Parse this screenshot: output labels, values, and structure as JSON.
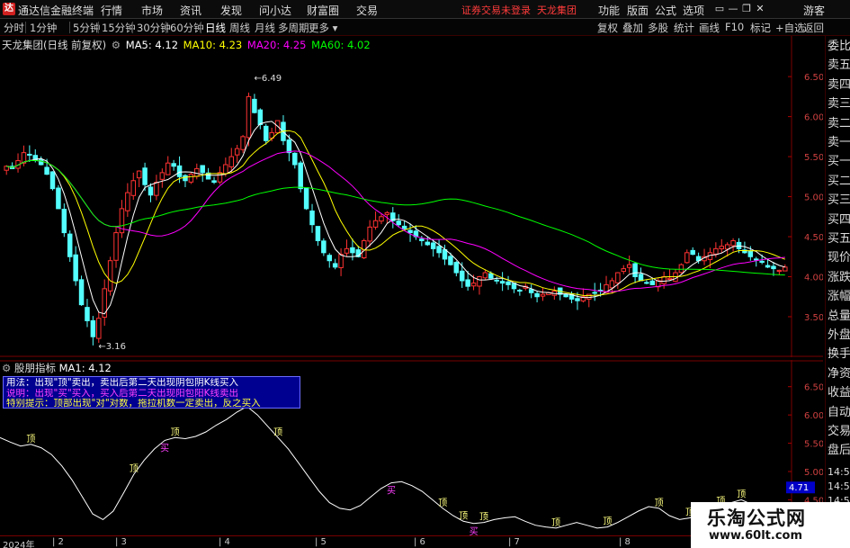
{
  "titlebar": {
    "app_title": "通达信金融终端",
    "logo_glyph": "达",
    "menus": [
      "行情",
      "市场",
      "资讯",
      "发现",
      "问小达",
      "财富圈",
      "交易"
    ],
    "login_notice": "证券交易未登录",
    "stock_name": "天龙集团",
    "right_buttons": [
      "功能",
      "版面",
      "公式",
      "选项"
    ],
    "guest_label": "游客",
    "window_controls": [
      "minimize-icon",
      "maximize-icon",
      "close-icon"
    ]
  },
  "toolbar": {
    "periods": [
      "分时",
      "1分钟",
      "5分钟",
      "15分钟",
      "30分钟",
      "60分钟",
      "日线",
      "周线",
      "月线",
      "多周期",
      "更多"
    ],
    "active_period": "日线",
    "right_buttons": [
      "复权",
      "叠加",
      "多股",
      "统计",
      "画线",
      "F10",
      "标记",
      "+自选",
      "返回"
    ]
  },
  "main_legend": {
    "title": "天龙集团(日线 前复权)",
    "ma5": "MA5: 4.12",
    "ma10": "MA10: 4.23",
    "ma20": "MA20: 4.25",
    "ma60": "MA60: 4.02",
    "colors": {
      "ma5": "#ffffff",
      "ma10": "#ffff00",
      "ma20": "#ff00ff",
      "ma60": "#00ff00"
    }
  },
  "indicator": {
    "name": "股朋指标",
    "ma1": "MA1: 4.12",
    "info_lines": [
      "用法：出现\"顶\"卖出，卖出后第二天出现阴包阴K线买入",
      "说明：出现\"买\"买入，买入后第二天出现阳包阳K线卖出",
      "特别提示：顶部出现\"对\"对数，拖拉机数一定卖出，反之买入"
    ],
    "current_value": "4.71",
    "top_label": "顶",
    "buy_label": "买"
  },
  "right_panel": {
    "labels": [
      "委比",
      "卖五",
      "卖四",
      "卖三",
      "卖二",
      "卖一",
      "买一",
      "买二",
      "买三",
      "买四",
      "买五",
      "现价",
      "涨跌",
      "涨幅",
      "总量",
      "外盘",
      "换手",
      "净资",
      "收益",
      "自动",
      "交易",
      "盘后"
    ],
    "time_labels": [
      "14:5",
      "14:5",
      "14:5",
      "15:0",
      "15:0",
      "15:0"
    ]
  },
  "bottom_axis": {
    "dates": [
      "2024年",
      "2",
      "3",
      "4",
      "5",
      "6",
      "7",
      "8"
    ]
  },
  "watermark": {
    "title": "乐淘公式网",
    "url": "www.60lt.com"
  },
  "chart_data": {
    "type": "candlestick",
    "title": "天龙集团(日线 前复权)",
    "y_axis_ticks": [
      3.5,
      4.0,
      4.5,
      5.0,
      5.5,
      6.0,
      6.5
    ],
    "ylim": [
      3.05,
      6.85
    ],
    "annotations": [
      {
        "label": "6.49",
        "value": 6.49
      },
      {
        "label": "3.16",
        "value": 3.16
      }
    ],
    "close": [
      5.38,
      5.35,
      5.45,
      5.55,
      5.52,
      5.46,
      5.4,
      5.28,
      5.1,
      4.85,
      4.55,
      4.25,
      3.95,
      3.65,
      3.45,
      3.25,
      3.48,
      3.85,
      4.2,
      4.55,
      4.85,
      5.05,
      5.2,
      5.32,
      5.15,
      5.02,
      5.18,
      5.3,
      5.42,
      5.38,
      5.25,
      5.2,
      5.28,
      5.35,
      5.3,
      5.22,
      5.18,
      5.3,
      5.4,
      5.5,
      5.6,
      5.75,
      6.25,
      6.05,
      5.9,
      5.7,
      5.8,
      5.95,
      5.7,
      5.55,
      5.4,
      5.1,
      4.85,
      4.65,
      4.45,
      4.3,
      4.2,
      4.12,
      4.28,
      4.35,
      4.3,
      4.25,
      4.45,
      4.62,
      4.7,
      4.75,
      4.8,
      4.7,
      4.65,
      4.6,
      4.55,
      4.5,
      4.45,
      4.4,
      4.35,
      4.3,
      4.22,
      4.15,
      4.05,
      3.95,
      3.88,
      3.92,
      4.0,
      4.05,
      3.98,
      3.95,
      3.92,
      3.9,
      3.85,
      3.82,
      3.88,
      3.8,
      3.75,
      3.78,
      3.8,
      3.82,
      3.78,
      3.75,
      3.72,
      3.7,
      3.75,
      3.78,
      3.8,
      3.82,
      3.9,
      3.95,
      4.05,
      4.1,
      4.15,
      4.0,
      3.95,
      3.92,
      3.9,
      3.95,
      4.0,
      3.98,
      4.05,
      4.15,
      4.3,
      4.28,
      4.2,
      4.25,
      4.3,
      4.35,
      4.38,
      4.4,
      4.45,
      4.35,
      4.3,
      4.25,
      4.22,
      4.18,
      4.12,
      4.1,
      4.08,
      4.12
    ],
    "series": [
      {
        "name": "MA5",
        "color": "#ffffff"
      },
      {
        "name": "MA10",
        "color": "#ffff00"
      },
      {
        "name": "MA20",
        "color": "#ff00ff"
      },
      {
        "name": "MA60",
        "color": "#00ff00"
      }
    ],
    "indicator_ticks": [
      4.0,
      4.5,
      5.0,
      5.5,
      6.0,
      6.5
    ],
    "indicator_ylim": [
      3.95,
      6.75
    ],
    "indicator_curve": [
      5.6,
      5.52,
      5.45,
      5.48,
      5.42,
      5.3,
      5.1,
      4.85,
      4.55,
      4.25,
      4.15,
      4.3,
      4.62,
      4.95,
      5.2,
      5.4,
      5.55,
      5.6,
      5.58,
      5.62,
      5.7,
      5.82,
      5.92,
      6.05,
      6.15,
      6.0,
      5.8,
      5.6,
      5.4,
      5.15,
      4.9,
      4.65,
      4.45,
      4.35,
      4.32,
      4.4,
      4.55,
      4.7,
      4.8,
      4.82,
      4.75,
      4.65,
      4.5,
      4.35,
      4.22,
      4.12,
      4.08,
      4.1,
      4.15,
      4.18,
      4.2,
      4.12,
      4.05,
      4.02,
      4.0,
      4.05,
      4.1,
      4.05,
      4.0,
      4.02,
      4.1,
      4.2,
      4.3,
      4.38,
      4.35,
      4.22,
      4.15,
      4.18,
      4.25,
      4.32,
      4.38,
      4.45,
      4.5,
      4.42,
      4.35,
      4.28,
      4.24
    ],
    "indicator_marks": [
      {
        "label": "顶",
        "i": 3
      },
      {
        "label": "顶",
        "i": 13
      },
      {
        "label": "顶",
        "i": 17
      },
      {
        "label": "买",
        "i": 16
      },
      {
        "label": "顶",
        "i": 27
      },
      {
        "label": "买",
        "i": 38
      },
      {
        "label": "顶",
        "i": 43
      },
      {
        "label": "顶",
        "i": 45
      },
      {
        "label": "顶",
        "i": 47
      },
      {
        "label": "买",
        "i": 46
      },
      {
        "label": "顶",
        "i": 54
      },
      {
        "label": "顶",
        "i": 59
      },
      {
        "label": "顶",
        "i": 64
      },
      {
        "label": "顶",
        "i": 67
      },
      {
        "label": "买",
        "i": 68
      },
      {
        "label": "顶",
        "i": 70
      },
      {
        "label": "顶",
        "i": 72
      },
      {
        "label": "顶",
        "i": 75
      }
    ]
  }
}
